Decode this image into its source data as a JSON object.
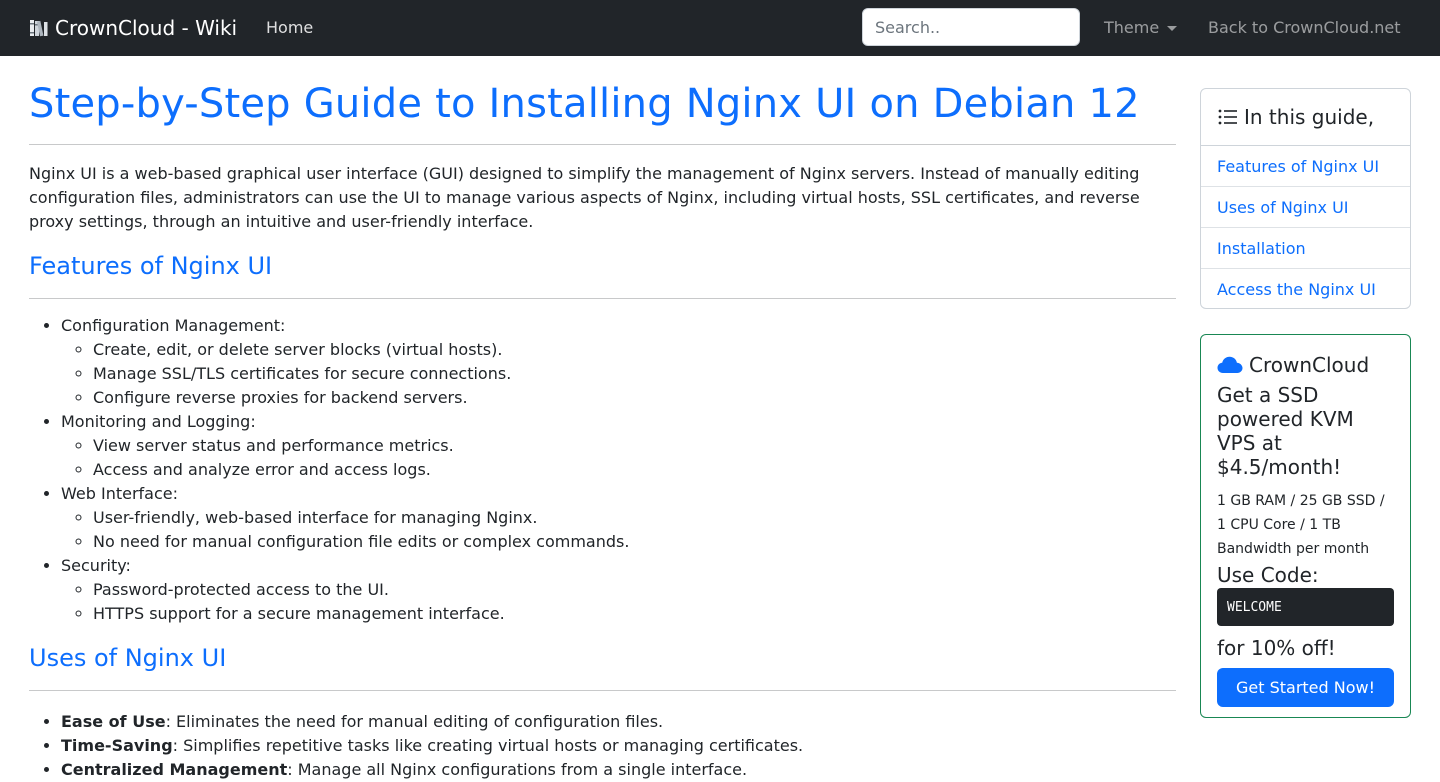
{
  "navbar": {
    "brand": "CrownCloud - Wiki",
    "brand_icon": "books-icon",
    "home": "Home",
    "search_placeholder": "Search..",
    "theme": "Theme",
    "back": "Back to CrownCloud.net"
  },
  "article": {
    "title": "Step-by-Step Guide to Installing Nginx UI on Debian 12",
    "intro": "Nginx UI is a web-based graphical user interface (GUI) designed to simplify the management of Nginx servers. Instead of manually editing configuration files, administrators can use the UI to manage various aspects of Nginx, including virtual hosts, SSL certificates, and reverse proxy settings, through an intuitive and user-friendly interface.",
    "features": {
      "heading": "Features of Nginx UI",
      "groups": [
        {
          "label": "Configuration Management:",
          "items": [
            "Create, edit, or delete server blocks (virtual hosts).",
            "Manage SSL/TLS certificates for secure connections.",
            "Configure reverse proxies for backend servers."
          ]
        },
        {
          "label": "Monitoring and Logging:",
          "items": [
            "View server status and performance metrics.",
            "Access and analyze error and access logs."
          ]
        },
        {
          "label": "Web Interface:",
          "items": [
            "User-friendly, web-based interface for managing Nginx.",
            "No need for manual configuration file edits or complex commands."
          ]
        },
        {
          "label": "Security:",
          "items": [
            "Password-protected access to the UI.",
            "HTTPS support for a secure management interface."
          ]
        }
      ]
    },
    "uses": {
      "heading": "Uses of Nginx UI",
      "items": [
        {
          "term": "Ease of Use",
          "desc": ": Eliminates the need for manual editing of configuration files."
        },
        {
          "term": "Time-Saving",
          "desc": ": Simplifies repetitive tasks like creating virtual hosts or managing certificates."
        },
        {
          "term": "Centralized Management",
          "desc": ": Manage all Nginx configurations from a single interface."
        }
      ]
    }
  },
  "toc": {
    "header": "In this guide,",
    "items": [
      "Features of Nginx UI",
      "Uses of Nginx UI",
      "Installation",
      "Access the Nginx UI"
    ]
  },
  "promo": {
    "brand": "CrownCloud",
    "headline": "Get a SSD powered KVM VPS at $4.5/month!",
    "specs": "1 GB RAM / 25 GB SSD / 1 CPU Core / 1 TB Bandwidth per month",
    "use_code": "Use Code:",
    "code": "WELCOME",
    "off": "for 10% off!",
    "button": "Get Started Now!"
  },
  "colors": {
    "navbar_bg": "#212529",
    "link": "#0d6efd",
    "promo_border": "#198754",
    "button_bg": "#0d6efd"
  }
}
